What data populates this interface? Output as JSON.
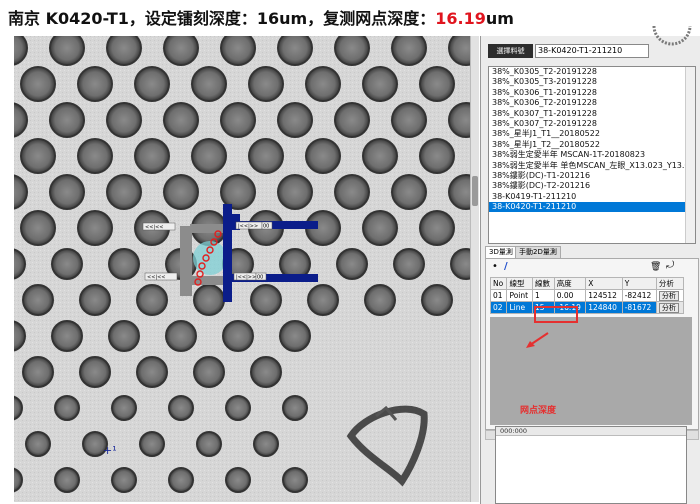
{
  "title": {
    "location": "南京",
    "sample": "K0420-T1",
    "sep1": "，设定镭刻深度：",
    "set_depth": "16um",
    "sep2": "，复测网点深度：",
    "measured_depth_value": "16.19",
    "measured_depth_unit": "um"
  },
  "image_view": {
    "tool_labels": [
      "<<|<<",
      "|<<|>>",
      "00",
      "<<|<<",
      "|<<|>>",
      "00"
    ],
    "cursor_mark": "+¹"
  },
  "panel": {
    "select_label": "選擇料號",
    "select_value": "38-K0420-T1-211210",
    "files": [
      "38%_K0305_T2-20191228",
      "38%_K0305_T3-20191228",
      "38%_K0306_T1-20191228",
      "38%_K0306_T2-20191228",
      "38%_K0307_T1-20191228",
      "38%_K0307_T2-20191228",
      "38%_星半J1_T1__20180522",
      "38%_星半J1_T2__20180522",
      "38%弱生定愛半年 MSCAN-1T-20180823",
      "38%弱生定愛半年 单色MSCAN_左眼_X13.023_Y13.01",
      "38%鏤影(DC)-T1-201216",
      "38%鏤影(DC)-T2-201216",
      "38-K0419-T1-211210",
      "38-K0420-T1-211210"
    ],
    "active_file_index": 13,
    "tabs": [
      "3D量測",
      "手動2D量測"
    ],
    "tools": {
      "dot": "•",
      "line": "/",
      "trash": "🗑",
      "measure": "⤾"
    },
    "table": {
      "headers": [
        "No",
        "線型",
        "線數",
        "高度",
        "X",
        "Y",
        "分析"
      ],
      "rows": [
        {
          "no": "01",
          "type": "Point",
          "count": "1",
          "height": "0.00",
          "x": "124512",
          "y": "-82412",
          "btn": "分析"
        },
        {
          "no": "02",
          "type": "Line",
          "count": "15",
          "height": "-16.19",
          "x": "124840",
          "y": "-81672",
          "btn": "分析"
        }
      ]
    },
    "annotation": "网点深度",
    "profile_label": "000:000"
  },
  "colors": {
    "accent_red": "#e0141e",
    "selection_blue": "#0078d7",
    "tool_navy": "#0b1d8a"
  }
}
